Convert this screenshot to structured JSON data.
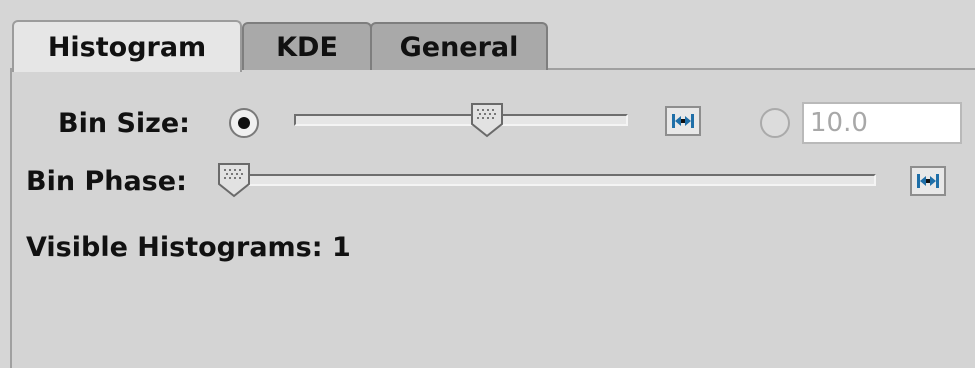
{
  "tabs": [
    {
      "label": "Histogram",
      "active": true
    },
    {
      "label": "KDE",
      "active": false
    },
    {
      "label": "General",
      "active": false
    }
  ],
  "bin_size": {
    "label": "Bin Size:",
    "slider_mode_selected": true,
    "slider_position_fraction": 0.57,
    "fix_button_icon": "lock-range-icon",
    "field_value": "10.0"
  },
  "bin_phase": {
    "label": "Bin Phase:",
    "slider_position_fraction": 0.0,
    "fix_button_icon": "lock-range-icon"
  },
  "visible_histograms": {
    "text": "Visible Histograms: 1"
  },
  "colors": {
    "background": "#d6d6d6",
    "active_tab": "#e6e6e6",
    "inactive_tab": "#a9a9a9",
    "icon_blue": "#1f6fa8"
  }
}
